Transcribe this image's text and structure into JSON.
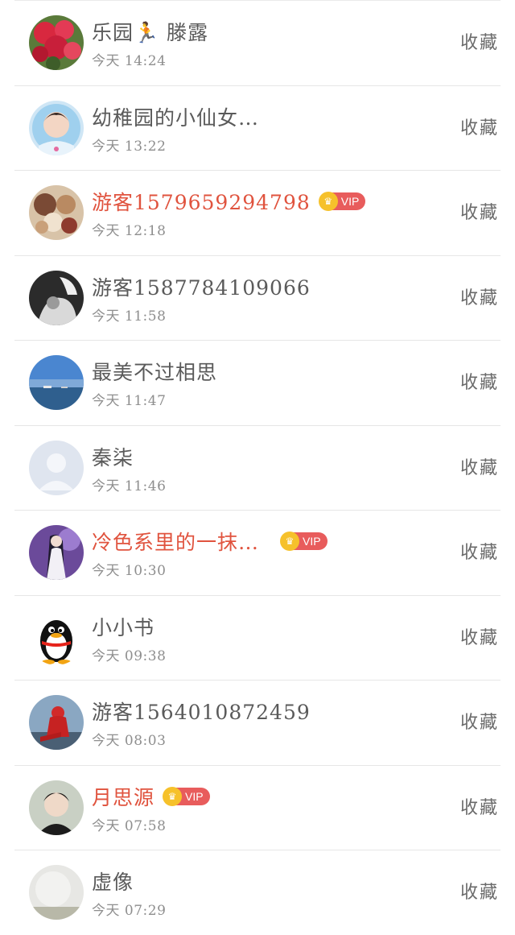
{
  "items": [
    {
      "name": "乐园🏃 滕露",
      "time": "今天 14:24",
      "vip": false,
      "action": "收藏",
      "avatar": "flower-avatar"
    },
    {
      "name": "幼稚园的小仙女…",
      "time": "今天 13:22",
      "vip": false,
      "action": "收藏",
      "avatar": "boy-avatar"
    },
    {
      "name": "游客1579659294798",
      "time": "今天 12:18",
      "vip": true,
      "vip_label": "VIP",
      "action": "收藏",
      "avatar": "anime-avatar"
    },
    {
      "name": "游客1587784109066",
      "time": "今天 11:58",
      "vip": false,
      "action": "收藏",
      "avatar": "bw-avatar"
    },
    {
      "name": "最美不过相思",
      "time": "今天 11:47",
      "vip": false,
      "action": "收藏",
      "avatar": "lake-avatar"
    },
    {
      "name": "秦柒",
      "time": "今天 11:46",
      "vip": false,
      "action": "收藏",
      "avatar": "default-avatar"
    },
    {
      "name": "冷色系里的一抹…",
      "time": "今天 10:30",
      "vip": true,
      "vip_label": "VIP",
      "action": "收藏",
      "avatar": "girl-avatar"
    },
    {
      "name": "小小书",
      "time": "今天 09:38",
      "vip": false,
      "action": "收藏",
      "avatar": "qq-penguin-avatar"
    },
    {
      "name": "游客1564010872459",
      "time": "今天 08:03",
      "vip": false,
      "action": "收藏",
      "avatar": "red-hood-avatar"
    },
    {
      "name": "月思源",
      "time": "今天 07:58",
      "vip": true,
      "vip_label": "VIP",
      "action": "收藏",
      "avatar": "young-man-avatar"
    },
    {
      "name": "虚像",
      "time": "今天 07:29",
      "vip": false,
      "action": "收藏",
      "avatar": "mist-avatar"
    }
  ],
  "colors": {
    "vip_name": "#e0533e",
    "vip_badge": "#e85c5c",
    "crown": "#f6c12b",
    "text": "#5a5a5a",
    "time": "#8e8e8e"
  }
}
